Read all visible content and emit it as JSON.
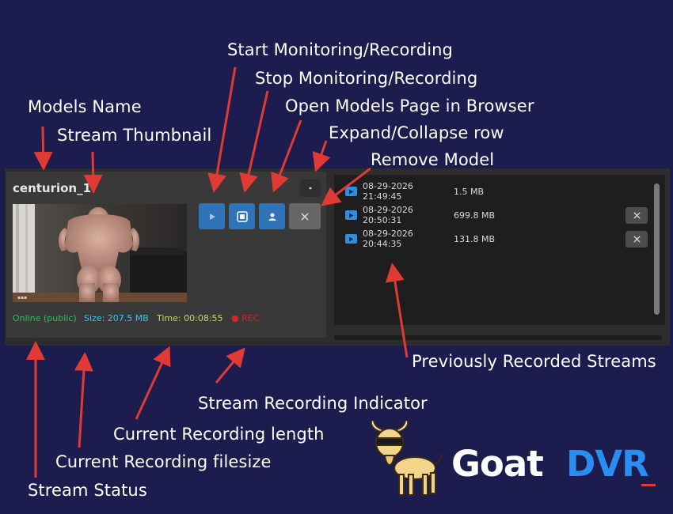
{
  "annotations": {
    "start": "Start Monitoring/Recording",
    "stop": "Stop Monitoring/Recording",
    "open_page": "Open Models Page in Browser",
    "models_name": "Models Name",
    "expand": "Expand/Collapse row",
    "thumbnail": "Stream Thumbnail",
    "remove": "Remove Model",
    "previous": "Previously Recorded Streams",
    "rec_indicator": "Stream Recording Indicator",
    "rec_length": "Current Recording length",
    "filesize": "Current Recording filesize",
    "status": "Stream Status"
  },
  "model": {
    "name": "centurion_1",
    "status": "Online (public)",
    "size": "Size: 207.5 MB",
    "time": "Time: 00:08:55",
    "rec": "REC"
  },
  "recordings": [
    {
      "date": "08-29-2026 21:49:45",
      "size": "1.5 MB",
      "deletable": false
    },
    {
      "date": "08-29-2026 20:50:31",
      "size": "699.8 MB",
      "deletable": true
    },
    {
      "date": "08-29-2026 20:44:35",
      "size": "131.8 MB",
      "deletable": true
    }
  ],
  "logo": {
    "word1": "Goat",
    "word2": "DVR"
  },
  "colors": {
    "background": "#1c1c4f",
    "arrow": "#e03a34",
    "button_blue": "#2f73b8",
    "status_green": "#2fc05a",
    "size_cyan": "#3bc4e6",
    "time_yellow": "#c8d46a",
    "rec_red": "#d42424",
    "logo_blue": "#2a8ef0"
  },
  "icons": [
    "play-icon",
    "stop-icon",
    "person-icon",
    "close-icon",
    "caret-down-icon",
    "video-file-icon",
    "goat-mascot"
  ]
}
